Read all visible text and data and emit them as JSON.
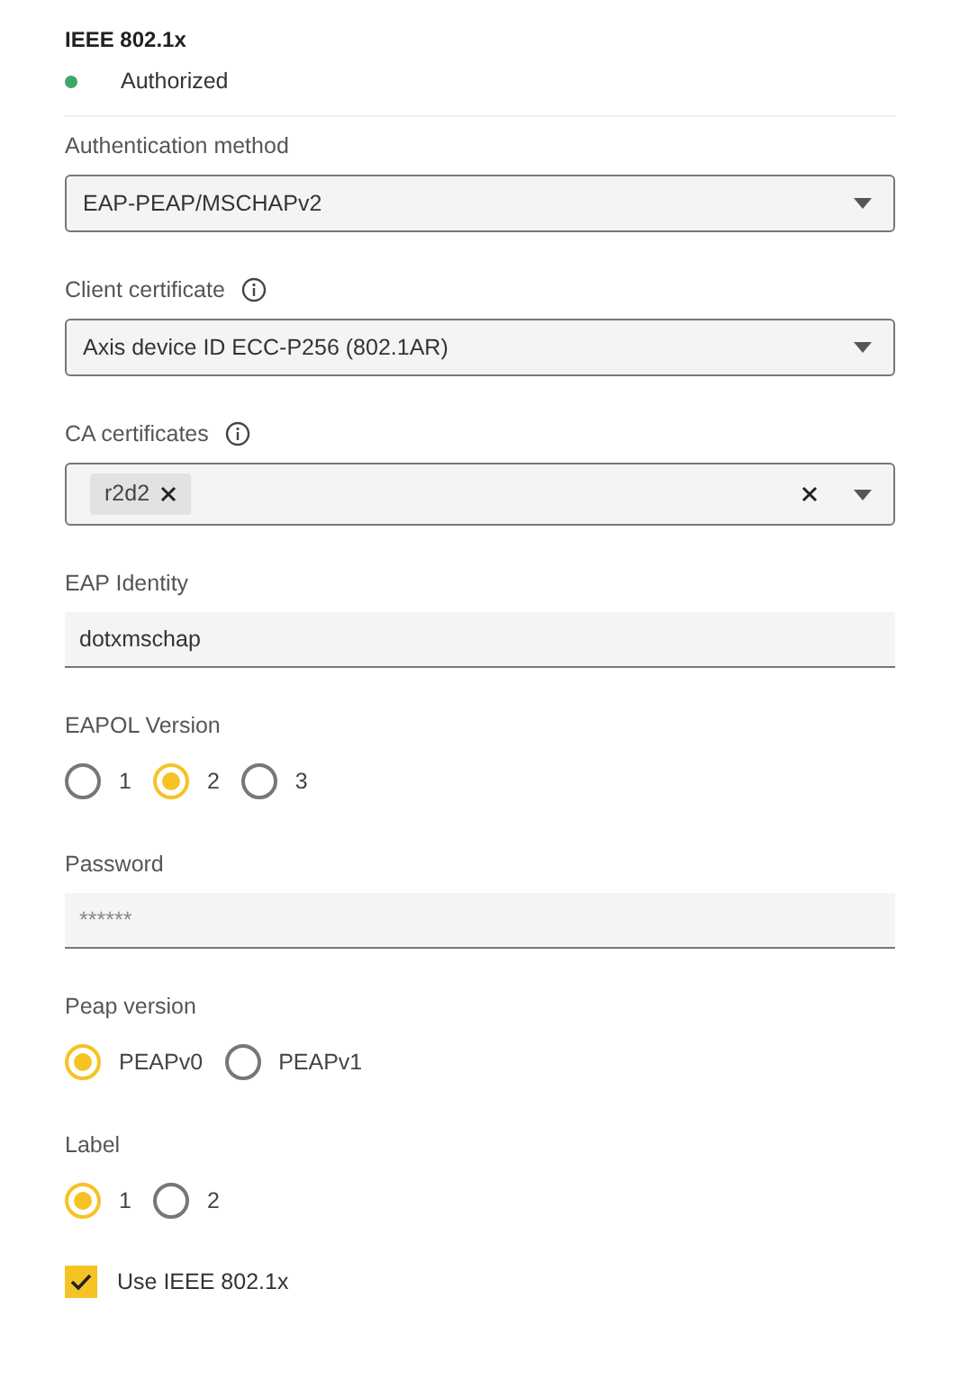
{
  "title": "IEEE 802.1x",
  "status": {
    "text": "Authorized"
  },
  "fields": [
    {
      "kind": "select",
      "label": "Authentication method",
      "value": "EAP-PEAP/MSCHAPv2"
    },
    {
      "kind": "select",
      "label": "Client certificate",
      "info": true,
      "value": "Axis device ID ECC-P256 (802.1AR)"
    },
    {
      "kind": "multiselect",
      "label": "CA certificates",
      "info": true,
      "chips": [
        "r2d2"
      ]
    },
    {
      "kind": "text",
      "label": "EAP Identity",
      "value": "dotxmschap"
    },
    {
      "kind": "radio",
      "label": "EAPOL Version",
      "options": [
        {
          "label": "1",
          "selected": false
        },
        {
          "label": "2",
          "selected": true
        },
        {
          "label": "3",
          "selected": false
        }
      ]
    },
    {
      "kind": "text",
      "label": "Password",
      "placeholder": "******"
    },
    {
      "kind": "radio",
      "label": "Peap version",
      "options": [
        {
          "label": "PEAPv0",
          "selected": true
        },
        {
          "label": "PEAPv1",
          "selected": false
        }
      ]
    },
    {
      "kind": "radio",
      "label": "Label",
      "options": [
        {
          "label": "1",
          "selected": true
        },
        {
          "label": "2",
          "selected": false
        }
      ]
    }
  ],
  "use_checkbox": {
    "label": "Use IEEE 802.1x",
    "checked": true
  }
}
